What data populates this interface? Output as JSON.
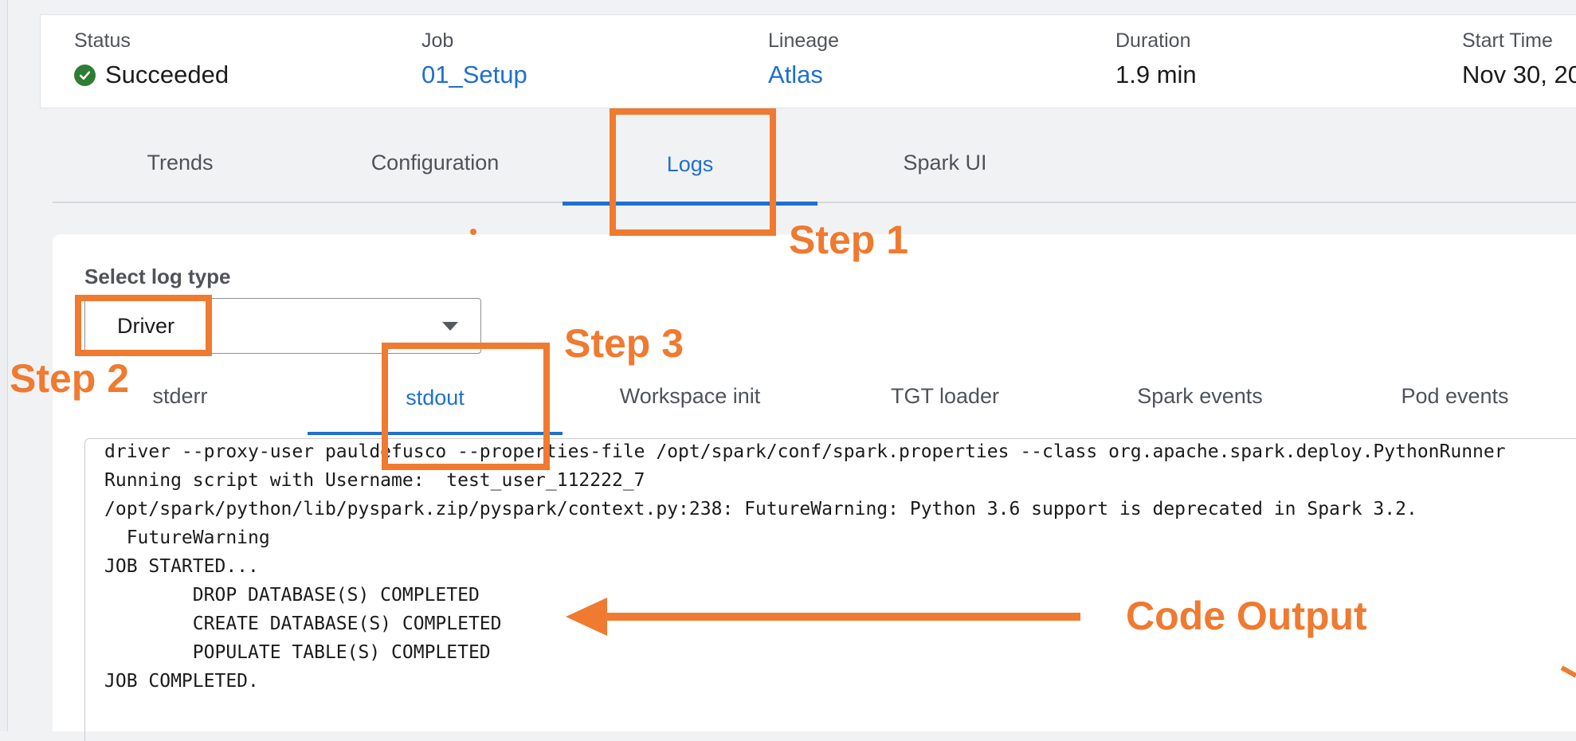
{
  "summary": {
    "status_label": "Status",
    "status_value": "Succeeded",
    "job_label": "Job",
    "job_value": "01_Setup",
    "lineage_label": "Lineage",
    "lineage_value": "Atlas",
    "duration_label": "Duration",
    "duration_value": "1.9 min",
    "start_label": "Start Time",
    "start_value": "Nov 30, 20"
  },
  "tabs": [
    "Trends",
    "Configuration",
    "Logs",
    "Spark UI"
  ],
  "active_tab": "Logs",
  "log_panel": {
    "select_label": "Select log type",
    "select_value": "Driver",
    "subtabs": [
      "stderr",
      "stdout",
      "Workspace init",
      "TGT loader",
      "Spark events",
      "Pod events"
    ],
    "active_subtab": "stdout",
    "lines": [
      "driver --proxy-user pauldefusco --properties-file /opt/spark/conf/spark.properties --class org.apache.spark.deploy.PythonRunner",
      "Running script with Username:  test_user_112222_7",
      "/opt/spark/python/lib/pyspark.zip/pyspark/context.py:238: FutureWarning: Python 3.6 support is deprecated in Spark 3.2.",
      "  FutureWarning",
      "JOB STARTED...",
      "        DROP DATABASE(S) COMPLETED",
      "        CREATE DATABASE(S) COMPLETED",
      "        POPULATE TABLE(S) COMPLETED",
      "JOB COMPLETED."
    ]
  },
  "annotations": {
    "step1": "Step 1",
    "step2": "Step 2",
    "step3": "Step 3",
    "code_output": "Code Output",
    "color": "#ef7a30"
  },
  "colors": {
    "accent": "#1f6fd1",
    "success": "#2e7d32"
  },
  "icons": {
    "status": "check-circle-icon",
    "select": "chevron-down-icon"
  }
}
